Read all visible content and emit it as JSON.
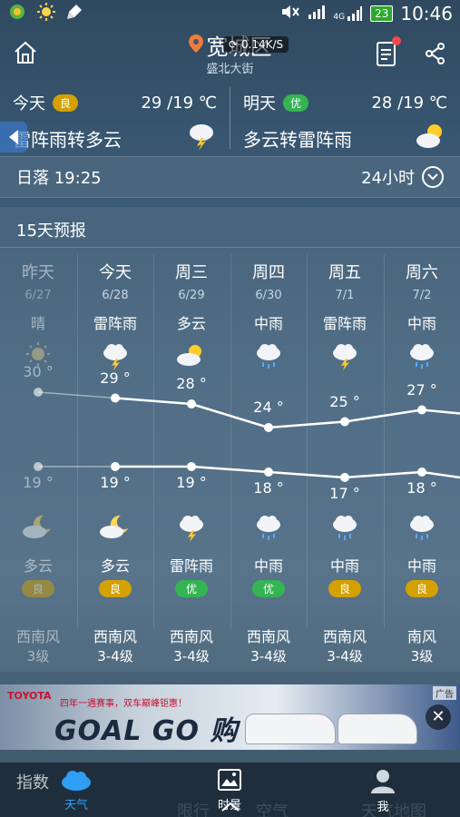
{
  "status_bar": {
    "signal_4g": "4G",
    "battery": "23",
    "time": "10:46"
  },
  "header": {
    "location": "宽城区",
    "sub_location": "盛北大街",
    "speed": "0.14K/S",
    "page_dots": "• • •"
  },
  "today": {
    "label": "今天",
    "aq": "良",
    "temps": "29 /19 ℃",
    "condition": "雷阵雨转多云",
    "icon": "thunder-cloud-icon"
  },
  "tomorrow": {
    "label": "明天",
    "aq": "优",
    "temps": "28 /19 ℃",
    "condition": "多云转雷阵雨",
    "icon": "partly-cloudy-icon"
  },
  "sunset": {
    "label": "日落 19:25",
    "hours24": "24小时"
  },
  "forecast": {
    "title": "15天预报",
    "days": [
      {
        "weekday": "昨天",
        "date": "6/27",
        "day_cond": "晴",
        "day_icon": "sun",
        "high": "30 °",
        "high_val": 30,
        "low": "19 °",
        "low_val": 19,
        "night_icon": "moon-cloud",
        "night_cond": "多云",
        "aq": "良",
        "aq_type": "good",
        "wind": "西南风",
        "level": "3级",
        "past": true
      },
      {
        "weekday": "今天",
        "date": "6/28",
        "day_cond": "雷阵雨",
        "day_icon": "thunder",
        "high": "29 °",
        "high_val": 29,
        "low": "19 °",
        "low_val": 19,
        "night_icon": "moon-cloud",
        "night_cond": "多云",
        "aq": "良",
        "aq_type": "good",
        "wind": "西南风",
        "level": "3-4级",
        "past": false
      },
      {
        "weekday": "周三",
        "date": "6/29",
        "day_cond": "多云",
        "day_icon": "sun-cloud",
        "high": "28 °",
        "high_val": 28,
        "low": "19 °",
        "low_val": 19,
        "night_icon": "thunder",
        "night_cond": "雷阵雨",
        "aq": "优",
        "aq_type": "excellent",
        "wind": "西南风",
        "level": "3-4级",
        "past": false
      },
      {
        "weekday": "周四",
        "date": "6/30",
        "day_cond": "中雨",
        "day_icon": "rain",
        "high": "24 °",
        "high_val": 24,
        "low": "18 °",
        "low_val": 18,
        "night_icon": "rain",
        "night_cond": "中雨",
        "aq": "优",
        "aq_type": "excellent",
        "wind": "西南风",
        "level": "3-4级",
        "past": false
      },
      {
        "weekday": "周五",
        "date": "7/1",
        "day_cond": "雷阵雨",
        "day_icon": "thunder",
        "high": "25 °",
        "high_val": 25,
        "low": "17 °",
        "low_val": 17,
        "night_icon": "rain",
        "night_cond": "中雨",
        "aq": "良",
        "aq_type": "good",
        "wind": "西南风",
        "level": "3-4级",
        "past": false
      },
      {
        "weekday": "周六",
        "date": "7/2",
        "day_cond": "中雨",
        "day_icon": "rain",
        "high": "27 °",
        "high_val": 27,
        "low": "18 °",
        "low_val": 18,
        "night_icon": "rain",
        "night_cond": "中雨",
        "aq": "良",
        "aq_type": "good",
        "wind": "南风",
        "level": "3级",
        "past": false
      }
    ]
  },
  "ad": {
    "brand": "TOYOTA",
    "slogan": "四年一遇赛事，双车巅峰钜惠！",
    "headline": "GOAL GO 购",
    "tag": "广告",
    "close": "✕"
  },
  "bottom_nav": {
    "ghost_left": "指数",
    "weather": "天气",
    "scenery": "时景",
    "me": "我",
    "ghost_a": "限行",
    "ghost_b": "空气",
    "ghost_c": "天气地图"
  }
}
